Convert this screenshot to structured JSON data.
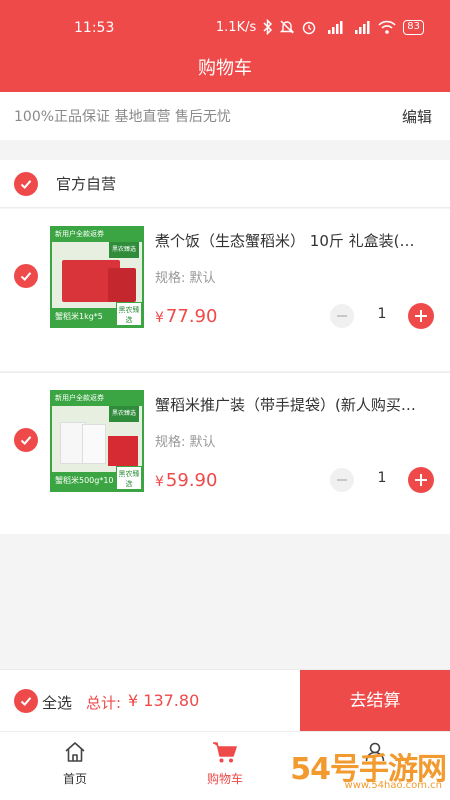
{
  "status_bar": {
    "time": "11:53",
    "speed": "1.1K/s",
    "battery": "83",
    "icons": [
      "bluetooth-icon",
      "mute-icon",
      "alarm-icon",
      "hd-signal-icon",
      "hd-signal-icon",
      "wifi-icon",
      "battery-icon"
    ]
  },
  "header": {
    "title": "购物车"
  },
  "notice": {
    "text": "100%正品保证 基地直营 售后无忧",
    "edit_label": "编辑"
  },
  "store": {
    "name": "官方自营",
    "checked": true
  },
  "items": [
    {
      "title": "煮个饭（生态蟹稻米） 10斤 礼盒装(…",
      "spec": "规格: 默认",
      "currency": "¥",
      "price": "77.90",
      "quantity": "1",
      "checked": true,
      "thumb": {
        "top_text": "新用户全款返券",
        "badge": "黑农臻选",
        "bottom_text": "蟹稻米1kg*5",
        "corner": "黑农臻选"
      }
    },
    {
      "title": "蟹稻米推广装（带手提袋）(新人购买…",
      "spec": "规格: 默认",
      "currency": "¥",
      "price": "59.90",
      "quantity": "1",
      "checked": true,
      "thumb": {
        "top_text": "新用户全款返券",
        "badge": "黑农臻选",
        "bottom_text": "蟹稻米500g*10",
        "corner": "黑农臻选"
      }
    }
  ],
  "checkout": {
    "select_all": "全选",
    "total_label": "总计:",
    "total": "¥ 137.80",
    "button": "去结算"
  },
  "tabbar": [
    {
      "label": "首页",
      "icon": "home-icon",
      "active": false
    },
    {
      "label": "购物车",
      "icon": "cart-icon",
      "active": true
    },
    {
      "label": "",
      "icon": "user-icon",
      "active": false
    }
  ],
  "watermark": {
    "text": "54号手游网",
    "sub": "www.54hao.com.cn"
  },
  "colors": {
    "accent": "#ef4a4a",
    "background": "#f4f4f4",
    "thumb_green": "#3aa542"
  }
}
